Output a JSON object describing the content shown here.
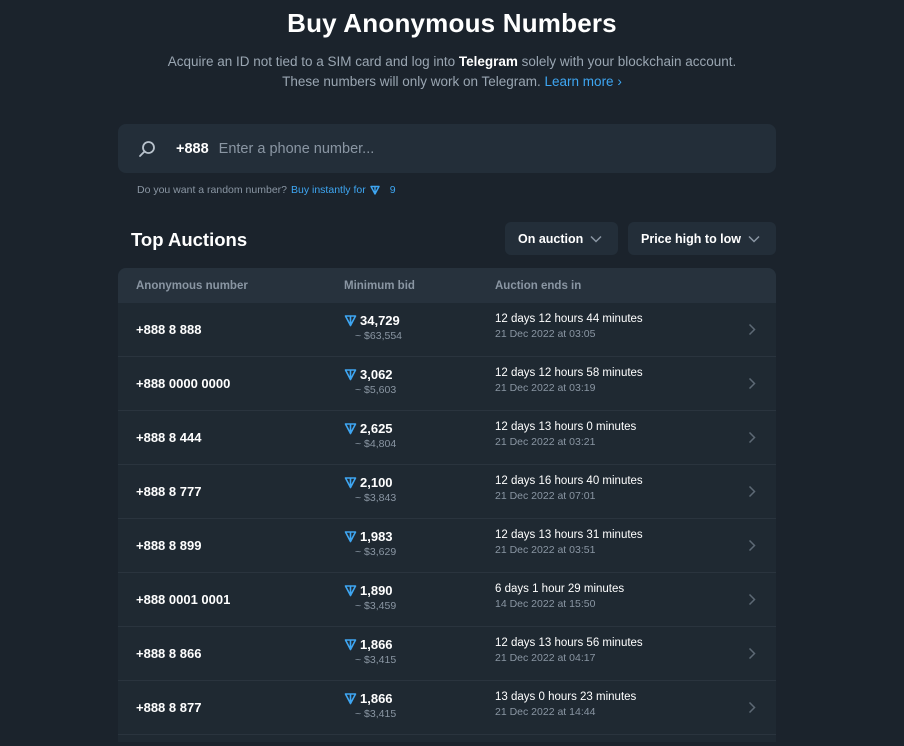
{
  "header": {
    "title": "Buy Anonymous Numbers",
    "subtitle_pre": "Acquire an ID not tied to a SIM card and log into ",
    "subtitle_bold": "Telegram",
    "subtitle_post": " solely with your blockchain account. These numbers will only work on Telegram. ",
    "learn_more": "Learn more ›"
  },
  "search": {
    "prefix": "+888",
    "placeholder": "Enter a phone number...",
    "icon": "search-icon"
  },
  "random": {
    "question": "Do you want a random number?",
    "link": "Buy instantly for",
    "price": "9"
  },
  "auctions": {
    "title": "Top Auctions",
    "filter_label": "On auction",
    "sort_label": "Price high to low",
    "columns": [
      "Anonymous number",
      "Minimum bid",
      "Auction ends in"
    ],
    "rows": [
      {
        "number": "+888 8 888",
        "bid": "34,729",
        "usd": "~ $63,554",
        "ends": "12 days 12 hours 44 minutes",
        "date": "21 Dec 2022 at 03:05"
      },
      {
        "number": "+888 0000 0000",
        "bid": "3,062",
        "usd": "~ $5,603",
        "ends": "12 days 12 hours 58 minutes",
        "date": "21 Dec 2022 at 03:19"
      },
      {
        "number": "+888 8 444",
        "bid": "2,625",
        "usd": "~ $4,804",
        "ends": "12 days 13 hours 0 minutes",
        "date": "21 Dec 2022 at 03:21"
      },
      {
        "number": "+888 8 777",
        "bid": "2,100",
        "usd": "~ $3,843",
        "ends": "12 days 16 hours 40 minutes",
        "date": "21 Dec 2022 at 07:01"
      },
      {
        "number": "+888 8 899",
        "bid": "1,983",
        "usd": "~ $3,629",
        "ends": "12 days 13 hours 31 minutes",
        "date": "21 Dec 2022 at 03:51"
      },
      {
        "number": "+888 0001 0001",
        "bid": "1,890",
        "usd": "~ $3,459",
        "ends": "6 days 1 hour 29 minutes",
        "date": "14 Dec 2022 at 15:50"
      },
      {
        "number": "+888 8 866",
        "bid": "1,866",
        "usd": "~ $3,415",
        "ends": "12 days 13 hours 56 minutes",
        "date": "21 Dec 2022 at 04:17"
      },
      {
        "number": "+888 8 877",
        "bid": "1,866",
        "usd": "~ $3,415",
        "ends": "13 days 0 hours 23 minutes",
        "date": "21 Dec 2022 at 14:44"
      }
    ]
  },
  "colors": {
    "background": "#1b232c",
    "panel": "#232e39",
    "accent": "#3ea6f2",
    "muted": "#8a96a3"
  }
}
